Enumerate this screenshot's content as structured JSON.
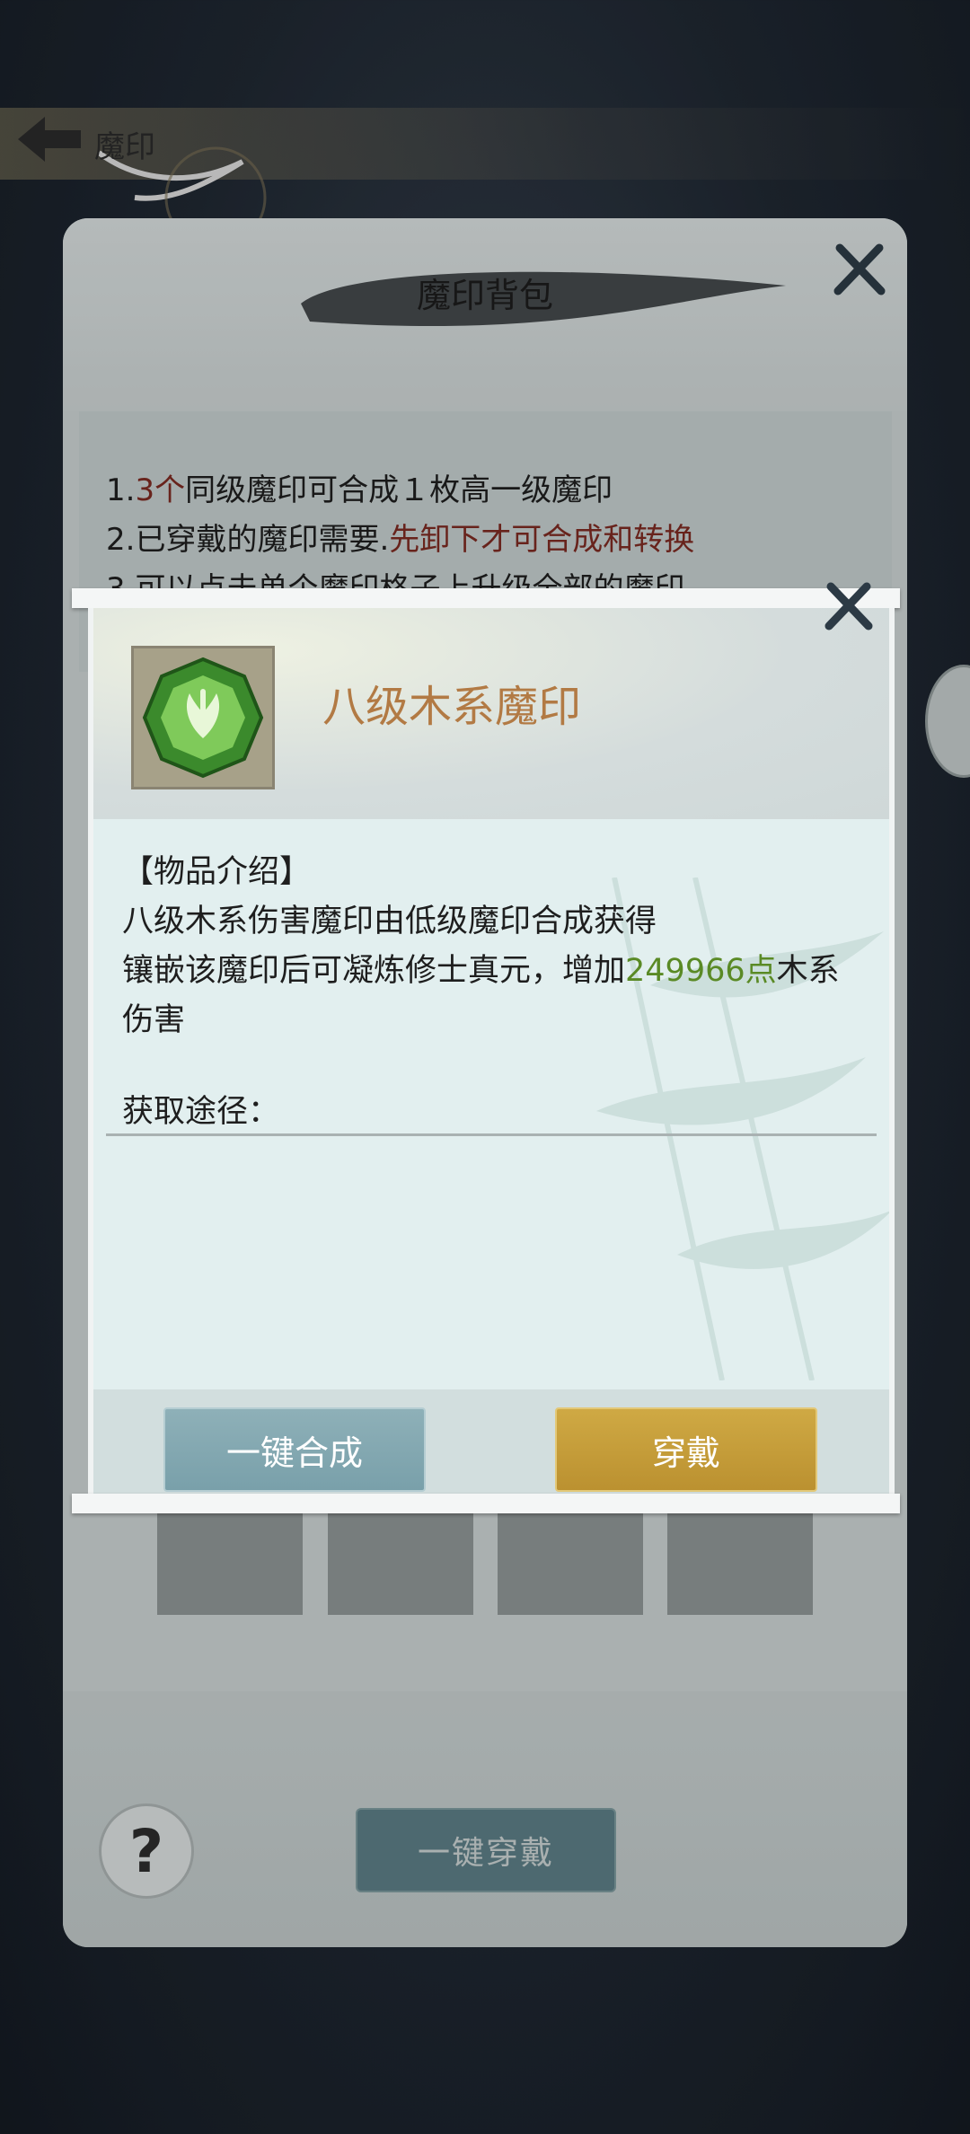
{
  "back": {
    "title": "魔印"
  },
  "panel": {
    "title": "魔印背包",
    "rules": [
      {
        "n": "1.",
        "red": "3个",
        "text": "同级魔印可合成１枚高一级魔印"
      },
      {
        "n": "2.",
        "text": "已穿戴的魔印需要.",
        "red": "先卸下才可合成和转换"
      },
      {
        "n": "3.",
        "text": "可以点击单个魔印格子上升级全部的魔印"
      }
    ],
    "equip_all_label": "一键穿戴",
    "help_label": "?"
  },
  "popup": {
    "item_name": "八级木系魔印",
    "intro_header": "【物品介绍】",
    "desc_line1": "八级木系伤害魔印由低级魔印合成获得",
    "desc_line2_pre": "镶嵌该魔印后可凝炼修士真元，增加",
    "desc_value": "249966点",
    "desc_line2_post": "木系",
    "desc_line3": "伤害",
    "source_label": "获取途径：",
    "merge_label": "一键合成",
    "wear_label": "穿戴"
  },
  "colors": {
    "accent_red": "#7b2a22",
    "value_green": "#5a8a25",
    "item_name": "#b27a44",
    "wear_gold": "#c9a23f",
    "merge_blue": "#84a8b1"
  },
  "icons": [
    "back-arrow-icon",
    "close-icon",
    "wood-seal-gem-icon",
    "help-icon"
  ]
}
